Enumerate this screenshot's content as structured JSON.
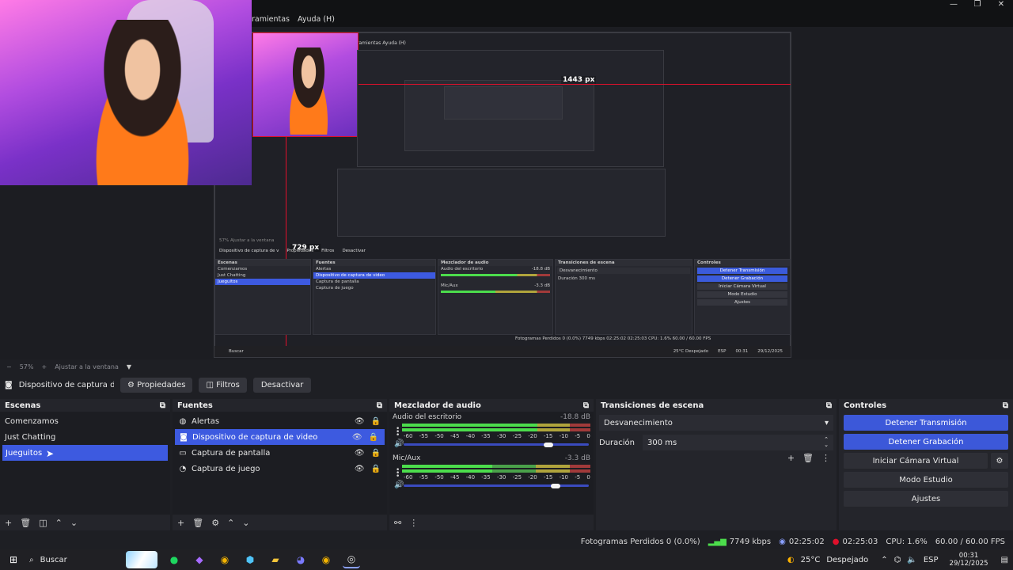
{
  "menu": {
    "items": [
      "ramientas",
      "Ayuda (H)"
    ]
  },
  "window_buttons": {
    "minimize": "—",
    "restore": "❐",
    "close": "✕"
  },
  "preview": {
    "measure_h": "1443 px",
    "measure_v": "729 px",
    "nested": {
      "menu": "ramientas   Ayuda (H)",
      "source_name": "Dispositivo de captura de v",
      "props": "Propiedades",
      "filters": "Filtros",
      "deactivate": "Desactivar",
      "scenes_title": "Escenas",
      "sources_title": "Fuentes",
      "mixer_title": "Mezclador de audio",
      "transitions_title": "Transiciones de escena",
      "controls_title": "Controles",
      "scenes": [
        "Comenzamos",
        "Just Chatting",
        "Jueguitos"
      ],
      "sources": [
        "Alertas",
        "Dispositivo de captura de video",
        "Captura de pantalla",
        "Captura de juego"
      ],
      "desktop_audio": "Audio del escritorio",
      "mic": "Mic/Aux",
      "mic_db": "-3.3 dB",
      "desktop_db": "-18.8 dB",
      "fade": "Desvanecimiento",
      "duration": "Duración",
      "duration_val": "300 ms",
      "stop_stream": "Detener Transmisión",
      "stop_rec": "Detener Grabación",
      "virtual_cam": "Iniciar Cámara Virtual",
      "studio": "Modo Estudio",
      "settings": "Ajustes",
      "status": "Fotogramas Perdidos 0 (0.0%)   7749 kbps   02:25:02   02:25:03   CPU: 1.6%   60.00 / 60.00 FPS",
      "zoom": "57%",
      "fit": "Ajustar a la ventana",
      "taskbar_search": "Buscar",
      "weather": "25°C  Despejado",
      "lang": "ESP",
      "time": "00:31",
      "date": "29/12/2025"
    }
  },
  "zoombar": {
    "minus": "−",
    "zoom": "57%",
    "plus": "+",
    "fit": "Ajustar a la ventana"
  },
  "source_toolbar": {
    "source_name": "Dispositivo de captura de v",
    "properties": "Propiedades",
    "filters": "Filtros",
    "deactivate": "Desactivar"
  },
  "scenes": {
    "title": "Escenas",
    "items": [
      "Comenzamos",
      "Just Chatting",
      "Jueguitos"
    ],
    "selected_index": 2
  },
  "sources": {
    "title": "Fuentes",
    "items": [
      {
        "label": "Alertas",
        "icon": "globe-icon"
      },
      {
        "label": "Dispositivo de captura de video",
        "icon": "camera-icon"
      },
      {
        "label": "Captura de pantalla",
        "icon": "monitor-icon"
      },
      {
        "label": "Captura de juego",
        "icon": "gamepad-icon"
      }
    ],
    "selected_index": 1
  },
  "mixer": {
    "title": "Mezclador de audio",
    "ticks": [
      "-60",
      "-55",
      "-50",
      "-45",
      "-40",
      "-35",
      "-30",
      "-25",
      "-20",
      "-15",
      "-10",
      "-5",
      "0"
    ],
    "channels": [
      {
        "name": "Audio del escritorio",
        "db": "-18.8 dB",
        "level": 0.72,
        "volume": 0.78
      },
      {
        "name": "Mic/Aux",
        "db": "-3.3 dB",
        "level": 0.48,
        "volume": 0.82
      }
    ]
  },
  "transitions": {
    "title": "Transiciones de escena",
    "selected": "Desvanecimiento",
    "duration_label": "Duración",
    "duration_value": "300 ms"
  },
  "controls": {
    "title": "Controles",
    "stop_stream": "Detener Transmisión",
    "stop_recording": "Detener Grabación",
    "start_virtual_cam": "Iniciar Cámara Virtual",
    "studio_mode": "Modo Estudio",
    "settings": "Ajustes"
  },
  "status": {
    "dropped": "Fotogramas Perdidos 0 (0.0%)",
    "bitrate": "7749 kbps",
    "stream_time": "02:25:02",
    "rec_time": "02:25:03",
    "cpu": "CPU: 1.6%",
    "fps": "60.00 / 60.00 FPS"
  },
  "taskbar": {
    "search": "Buscar",
    "weather": "25°C",
    "weather_desc": "Despejado",
    "lang": "ESP",
    "time": "00:31",
    "date": "29/12/2025"
  },
  "colors": {
    "accent": "#3c58d9",
    "red": "#e0102b",
    "bg": "#1e1f24",
    "dock": "#24252b"
  }
}
